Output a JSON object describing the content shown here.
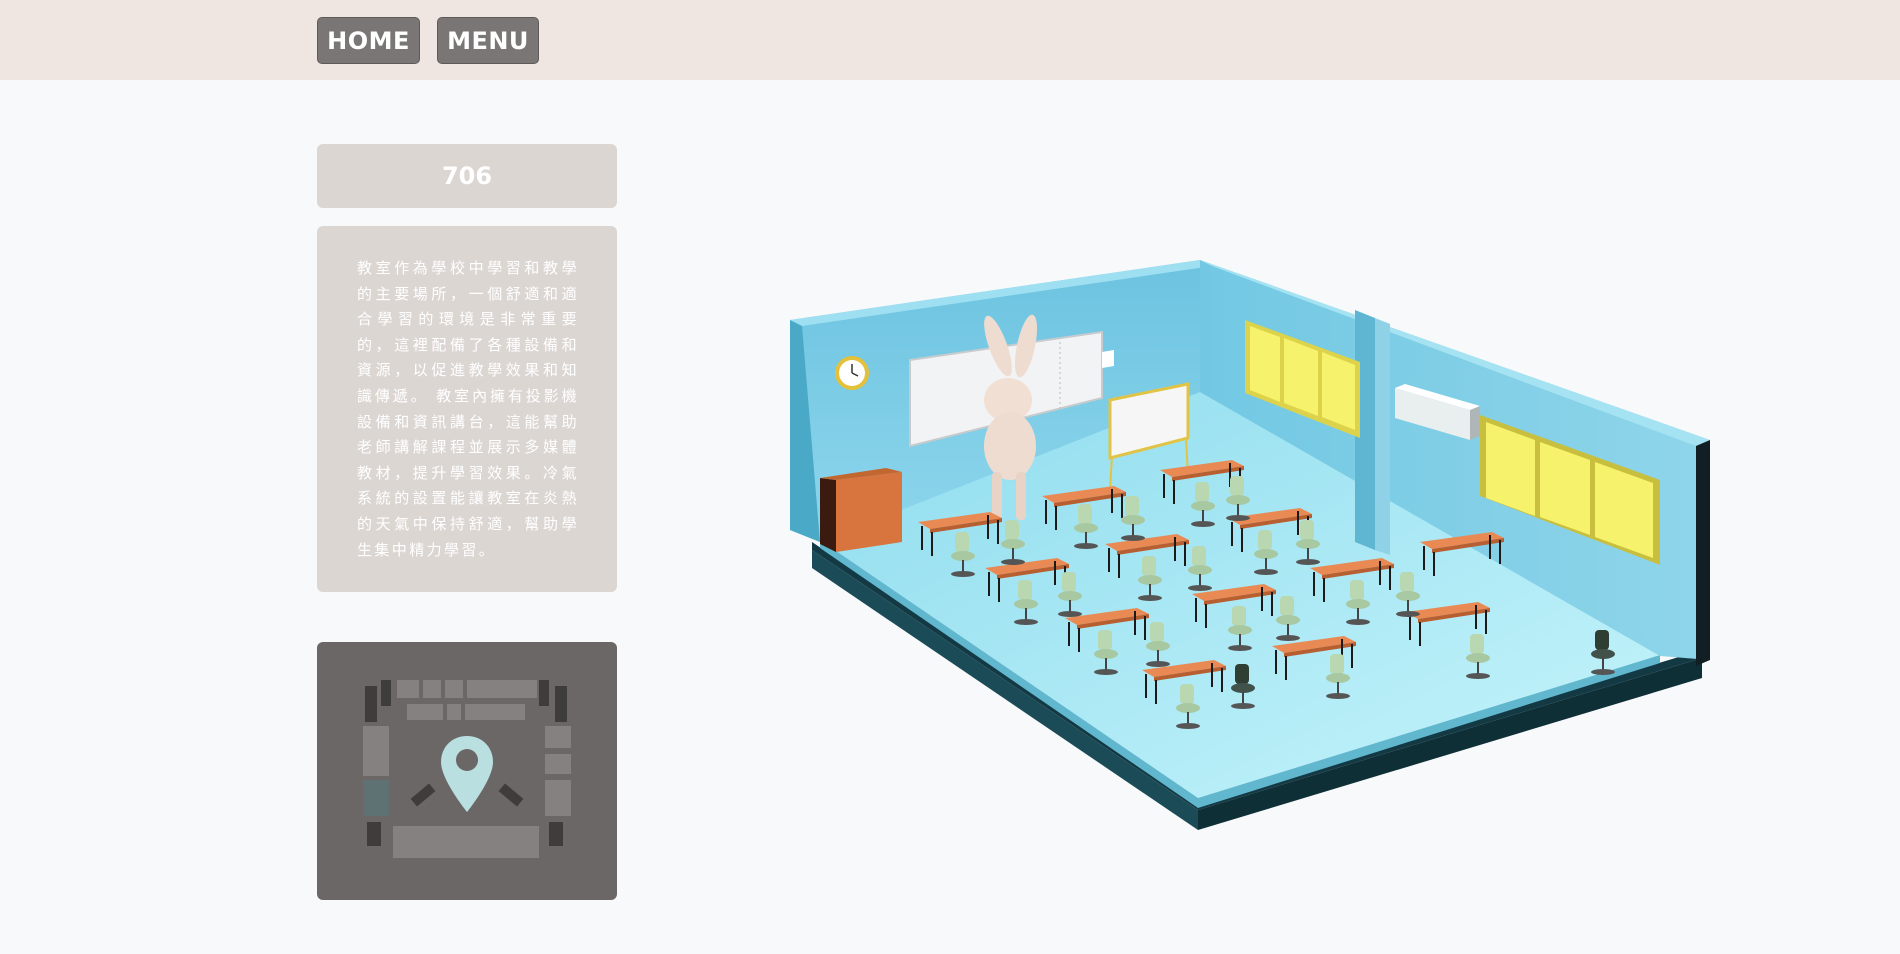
{
  "nav": {
    "home_label": "HOME",
    "menu_label": "MENU"
  },
  "room": {
    "title": "706",
    "description": "教室作為學校中學習和教學的主要場所，一個舒適和適合學習的環境是非常重要的，這裡配備了各種設備和資源，以促進教學效果和知識傳遞。 教室內擁有投影機設備和資訊講台，這能幫助老師講解課程並展示多媒體教材，提升學習效果。冷氣系統的設置能讓教室在炎熱的天氣中保持舒適，幫助學生集中精力學習。"
  },
  "map": {
    "icon": "location-pin-icon",
    "pin_color": "#b9dfe0"
  },
  "scene": {
    "wall_color": "#7fcde6",
    "floor_color": "#a9e8f5",
    "desk_color": "#e98a55",
    "chair_color": "#b9d7b1",
    "window_color": "#f6f26b"
  }
}
